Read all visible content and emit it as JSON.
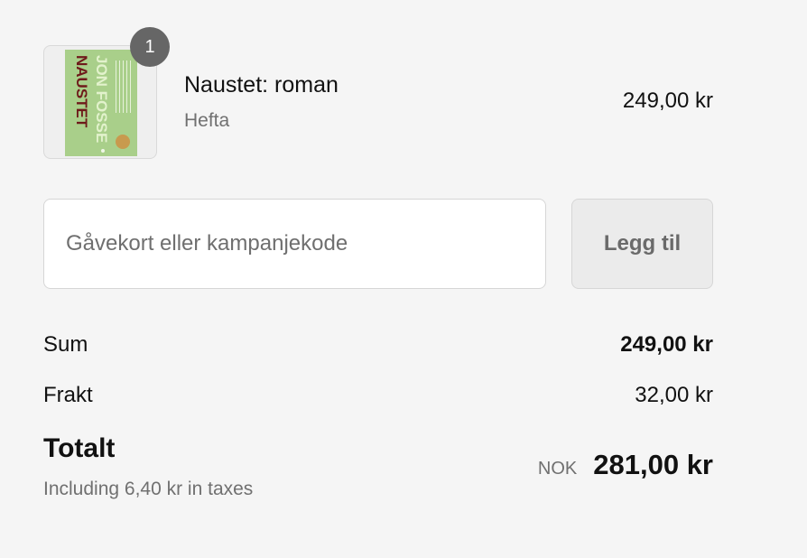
{
  "line_item": {
    "quantity": "1",
    "name": "Naustet: roman",
    "variant": "Hefta",
    "price": "249,00 kr",
    "cover": {
      "author": "JON FOSSE",
      "title": "NAUSTET"
    }
  },
  "discount": {
    "placeholder": "Gåvekort eller kampanjekode",
    "value": "",
    "apply_label": "Legg til"
  },
  "summary": {
    "subtotal_label": "Sum",
    "subtotal_value": "249,00 kr",
    "shipping_label": "Frakt",
    "shipping_value": "32,00 kr",
    "total_label": "Totalt",
    "tax_note": "Including 6,40 kr in taxes",
    "currency": "NOK",
    "total_value": "281,00 kr"
  },
  "colors": {
    "background": "#f5f5f5",
    "badge": "#666666",
    "cover_green": "#a9cf8a",
    "cover_title": "#6e1a1a",
    "muted_text": "#707070"
  }
}
